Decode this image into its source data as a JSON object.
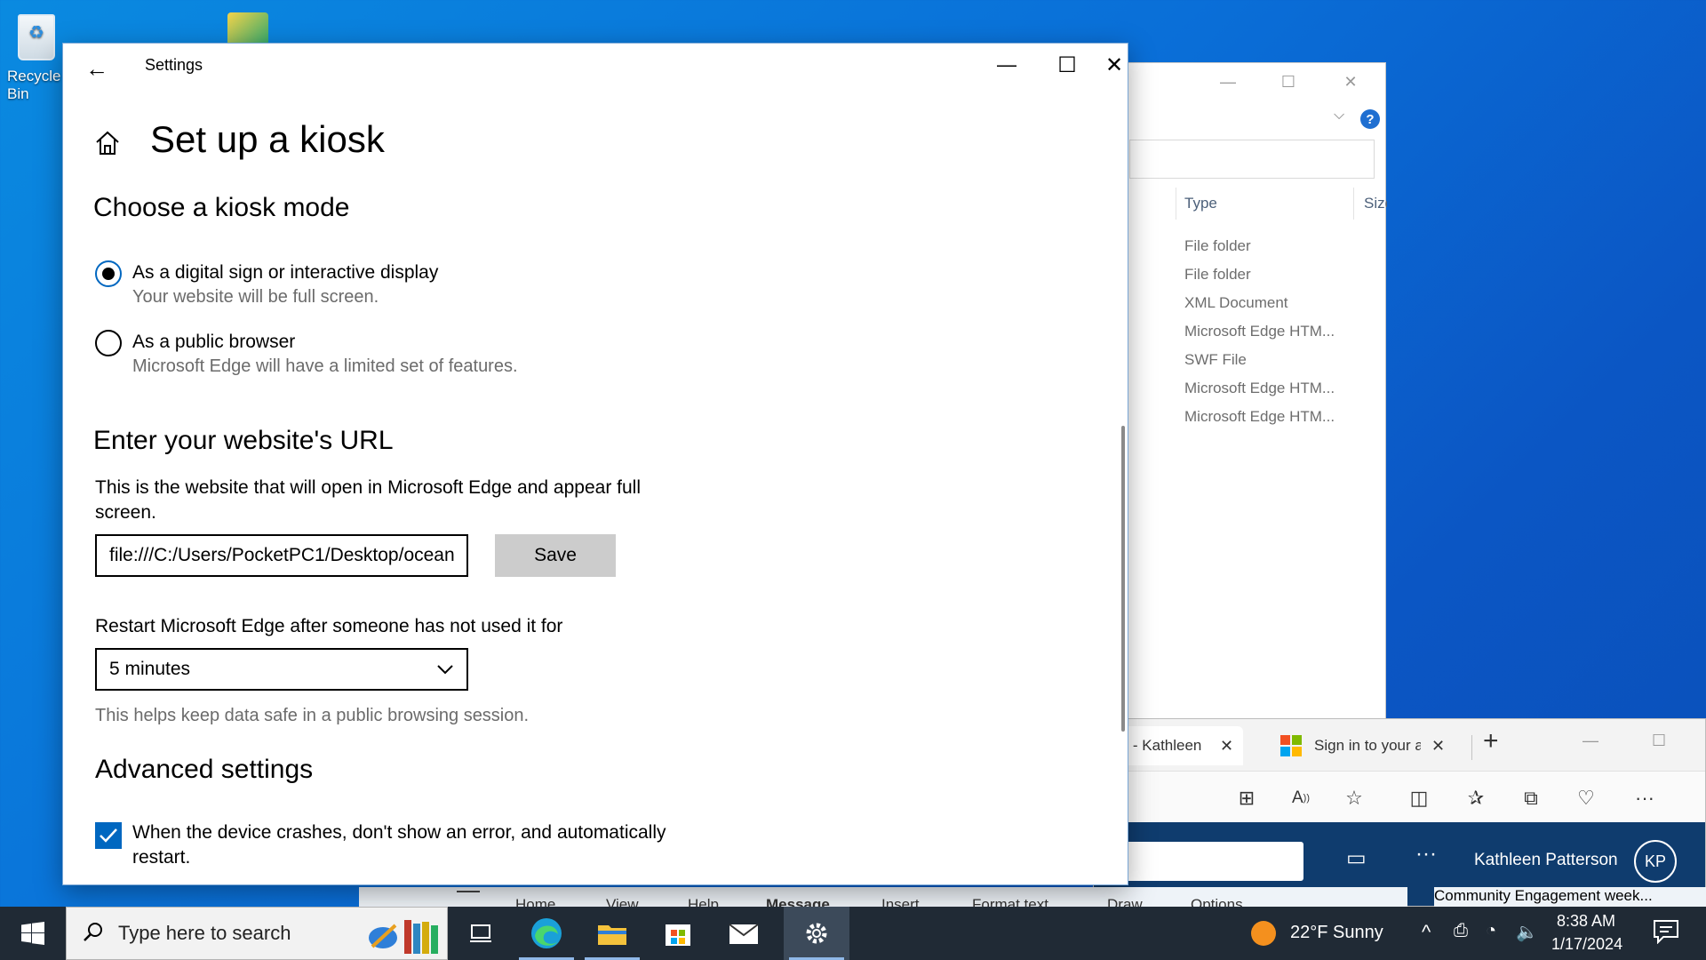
{
  "desktop": {
    "recycle_bin_label": "Recycle Bin"
  },
  "explorer": {
    "column_type": "Type",
    "column_size": "Size",
    "rows": [
      "File folder",
      "File folder",
      "XML Document",
      "Microsoft Edge HTM...",
      "SWF File",
      "Microsoft Edge HTM...",
      "Microsoft Edge HTM..."
    ]
  },
  "edge": {
    "tab1_label": "Mail - Kathleen",
    "tab2_label": "Sign in to your account",
    "user_name": "Kathleen Patterson",
    "user_initials": "KP",
    "ribbon_items": [
      "Home",
      "View",
      "Help",
      "Message",
      "Insert",
      "Format text",
      "Draw",
      "Options"
    ],
    "notification_text": "Community Engagement week..."
  },
  "settings": {
    "window_title": "Settings",
    "page_title": "Set up a kiosk",
    "kiosk_mode_heading": "Choose a kiosk mode",
    "option1_label": "As a digital sign or interactive display",
    "option1_desc": "Your website will be full screen.",
    "option2_label": "As a public browser",
    "option2_desc": "Microsoft Edge will have a limited set of features.",
    "selected_option": 1,
    "url_heading": "Enter your website's URL",
    "url_description": "This is the website that will open in Microsoft Edge and appear full screen.",
    "url_value": "file:///C:/Users/PocketPC1/Desktop/ocean",
    "save_label": "Save",
    "restart_label": "Restart Microsoft Edge after someone has not used it for",
    "restart_value": "5 minutes",
    "restart_help": "This helps keep data safe in a public browsing session.",
    "advanced_heading": "Advanced settings",
    "crash_option_label": "When the device crashes, don't show an error, and automatically restart.",
    "crash_option_checked": true
  },
  "taskbar": {
    "search_placeholder": "Type here to search",
    "weather": "22°F  Sunny",
    "time": "8:38 AM",
    "date": "1/17/2024"
  },
  "colors": {
    "accent": "#0067c0",
    "taskbar": "#202a35",
    "desktop": "#0a6fd8"
  }
}
